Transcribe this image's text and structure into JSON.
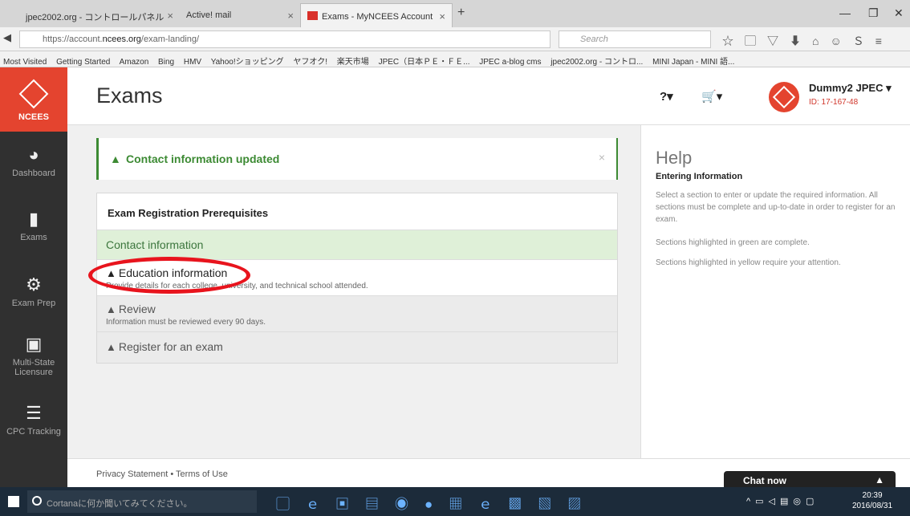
{
  "browser": {
    "tabs": [
      {
        "label": "jpec2002.org - コントロールパネル"
      },
      {
        "label": "Active! mail"
      },
      {
        "label": "Exams - MyNCEES Account"
      }
    ],
    "url_prefix": "https://account.",
    "url_domain": "ncees.org",
    "url_path": "/exam-landing/",
    "search_placeholder": "Search",
    "bookmarks": [
      "Most Visited",
      "Getting Started",
      "Amazon",
      "Bing",
      "HMV",
      "Yahoo!ショッピング",
      "ヤフオク!",
      "楽天市場",
      "JPEC（日本ＰＥ・ＦＥ...",
      "JPEC a-blog cms",
      "jpec2002.org - コントロ...",
      "MINI Japan - MINI 語..."
    ]
  },
  "sidebar": {
    "logo_text": "NCEES",
    "items": [
      {
        "label": "Dashboard"
      },
      {
        "label": "Exams"
      },
      {
        "label": "Exam Prep"
      },
      {
        "label": "Multi-State Licensure"
      },
      {
        "label": "CPC Tracking"
      }
    ]
  },
  "header": {
    "title": "Exams",
    "help_label": "?▾",
    "cart_label": "▾",
    "user_name": "Dummy2 JPEC ▾",
    "user_id": "ID: 17-167-48"
  },
  "alert": {
    "message": "Contact information updated",
    "close": "×"
  },
  "panel": {
    "title": "Exam Registration Prerequisites",
    "rows": [
      {
        "title": "Contact information"
      },
      {
        "title": "Education information",
        "description": "Provide details for each college, university, and technical school attended."
      },
      {
        "title": "Review",
        "description": "Information must be reviewed every 90 days."
      },
      {
        "title": "Register for an exam"
      }
    ]
  },
  "help": {
    "title": "Help",
    "subtitle": "Entering Information",
    "p1": "Select a section to enter or update the required information. All sections must be complete and up-to-date in order to register for an exam.",
    "p2": "Sections highlighted in green are complete.",
    "p3": "Sections highlighted in yellow require your attention."
  },
  "footer": {
    "privacy": "Privacy Statement",
    "sep": "•",
    "terms": "Terms of Use"
  },
  "chat": {
    "label": "Chat now"
  },
  "taskbar": {
    "cortana": "Cortanaに何か聞いてみてください。",
    "time": "20:39",
    "date": "2016/08/31"
  }
}
